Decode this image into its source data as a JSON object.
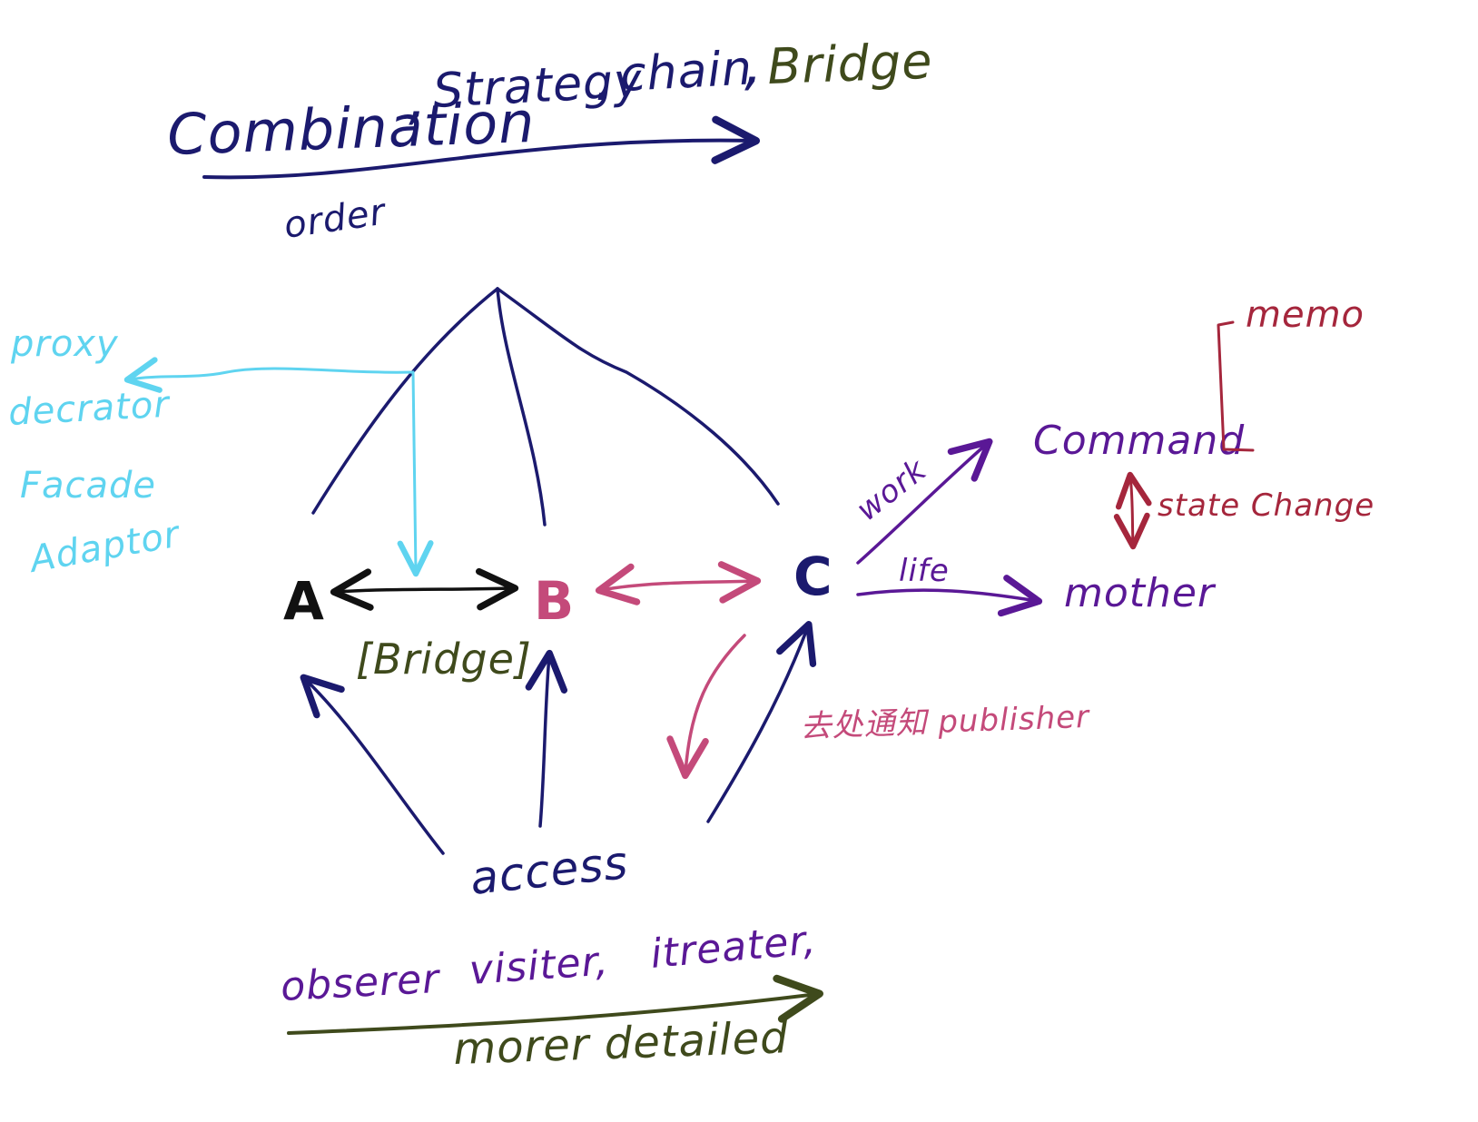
{
  "colors": {
    "navy": "#1b1a6e",
    "olive": "#3f4a1c",
    "cyan": "#5fd4f0",
    "pink": "#c44a7a",
    "purple": "#5a1896",
    "crimson": "#a5263c",
    "black": "#111111"
  },
  "header": {
    "combination": "Combination",
    "sep1": ",",
    "strategy": "Strategy",
    "sep2": ".",
    "chain": "chain",
    "sep3": ",",
    "bridge": "Bridge",
    "order": "order"
  },
  "nodes": {
    "a": "A",
    "b": "B",
    "c": "C"
  },
  "bridge_bracket": "[Bridge]",
  "structural": {
    "proxy": "proxy",
    "decorator": "decrator",
    "facade": "Facade",
    "adaptor": "Adaptor"
  },
  "behavior": {
    "work": "work",
    "life": "life",
    "command": "Command",
    "mother": "mother",
    "memo": "memo",
    "state_change": "state Change",
    "publisher": "去处通知 publisher"
  },
  "access": "access",
  "footer": {
    "observer": "obserer",
    "visitor": "visiter,",
    "iterator": "itreater,",
    "more_detailed": "morer detailed"
  }
}
